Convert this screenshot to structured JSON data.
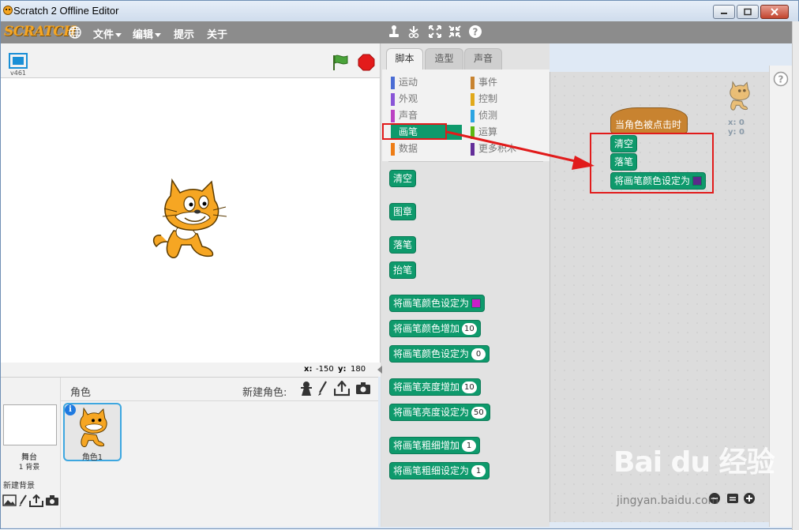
{
  "window": {
    "title": "Scratch 2 Offline Editor"
  },
  "menubar": {
    "logo": "SCRATCH",
    "items": [
      "文件",
      "编辑",
      "提示",
      "关于"
    ]
  },
  "stage": {
    "version": "v461",
    "mouse_x_label": "x:",
    "mouse_x": "-150",
    "mouse_y_label": "y:",
    "mouse_y": "180"
  },
  "sprites": {
    "title": "角色",
    "new_sprite_label": "新建角色:",
    "stage_name": "舞台",
    "stage_backdrops": "1 背景",
    "new_backdrop_label": "新建背景",
    "sprite1_name": "角色1",
    "info_badge": "i"
  },
  "palette": {
    "tabs": [
      "脚本",
      "造型",
      "声音"
    ],
    "categories": [
      {
        "label": "运动",
        "color": "#4a6cd4"
      },
      {
        "label": "事件",
        "color": "#c88330"
      },
      {
        "label": "外观",
        "color": "#8a55d7"
      },
      {
        "label": "控制",
        "color": "#e1a91a"
      },
      {
        "label": "声音",
        "color": "#bb42c3"
      },
      {
        "label": "侦测",
        "color": "#2ca5e2"
      },
      {
        "label": "画笔",
        "color": "#0e9a6c"
      },
      {
        "label": "运算",
        "color": "#5cb712"
      },
      {
        "label": "数据",
        "color": "#ee7d16"
      },
      {
        "label": "更多积木",
        "color": "#632d99"
      }
    ],
    "blocks": [
      {
        "label": "清空"
      },
      {
        "label": "图章"
      },
      {
        "label": "落笔"
      },
      {
        "label": "抬笔"
      },
      {
        "label": "将画笔颜色设定为",
        "swatch": "#c81ec8"
      },
      {
        "label": "将画笔颜色增加",
        "value": "10"
      },
      {
        "label": "将画笔颜色设定为",
        "value": "0"
      },
      {
        "label": "将画笔亮度增加",
        "value": "10"
      },
      {
        "label": "将画笔亮度设定为",
        "value": "50"
      },
      {
        "label": "将画笔粗细增加",
        "value": "1"
      },
      {
        "label": "将画笔粗细设定为",
        "value": "1"
      }
    ]
  },
  "scripts_area": {
    "sprite_x": "x: 0",
    "sprite_y": "y: 0",
    "hat_block": "当角色被点击时",
    "stack": [
      {
        "label": "清空"
      },
      {
        "label": "落笔"
      },
      {
        "label": "将画笔颜色设定为",
        "swatch": "#5a2a8a"
      }
    ]
  },
  "watermark": {
    "brand": "Bai du 经验",
    "url": "jingyan.baidu.com"
  },
  "colors": {
    "pen": "#0e9a6c",
    "events": "#c88330",
    "highlight": "#e11b1b"
  }
}
